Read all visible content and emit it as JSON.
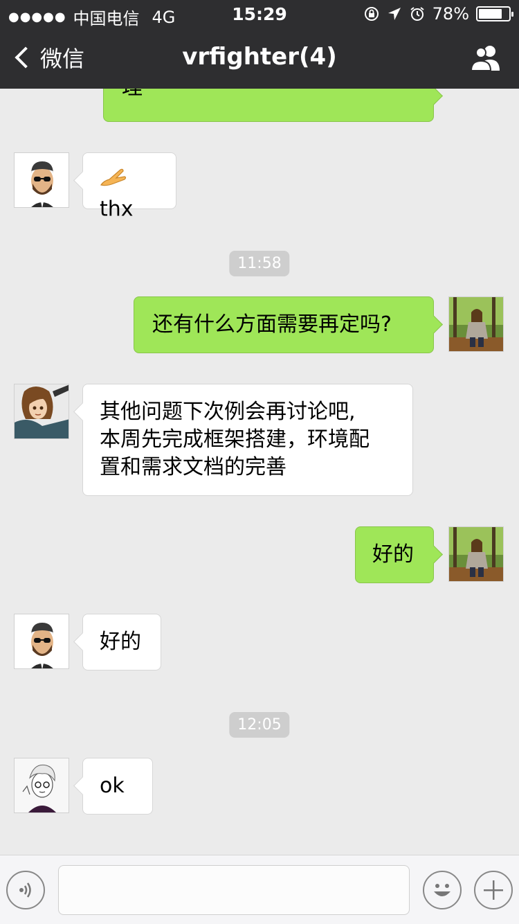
{
  "status_bar": {
    "signal_dots": "●●●●●",
    "carrier": "中国电信",
    "network": "4G",
    "time": "15:29",
    "battery_percent": "78%",
    "battery_level": 0.78
  },
  "nav": {
    "back_label": "微信",
    "title": "vrfighter(4)"
  },
  "messages": [
    {
      "side": "out",
      "text": "理"
    },
    {
      "side": "in",
      "text": "thx"
    },
    {
      "type": "timestamp",
      "text": "11:58"
    },
    {
      "side": "out",
      "text": "还有什么方面需要再定吗?"
    },
    {
      "side": "in",
      "lines": [
        "其他问题下次例会再讨论吧,",
        "本周先完成框架搭建，环境配",
        "置和需求文档的完善"
      ]
    },
    {
      "side": "out",
      "text": "好的"
    },
    {
      "side": "in",
      "text": "好的"
    },
    {
      "type": "timestamp",
      "text": "12:05"
    },
    {
      "side": "in",
      "text": "ok"
    }
  ],
  "colors": {
    "header_bg": "#2e2e30",
    "chat_bg": "#ebebeb",
    "outgoing_bubble": "#9fe658",
    "incoming_bubble": "#ffffff"
  },
  "icons": [
    "back-chevron-icon",
    "group-members-icon",
    "voice-icon",
    "emoji-icon",
    "plus-icon",
    "hand-emoji-icon",
    "alarm-icon",
    "location-arrow-icon",
    "rotation-lock-icon"
  ]
}
